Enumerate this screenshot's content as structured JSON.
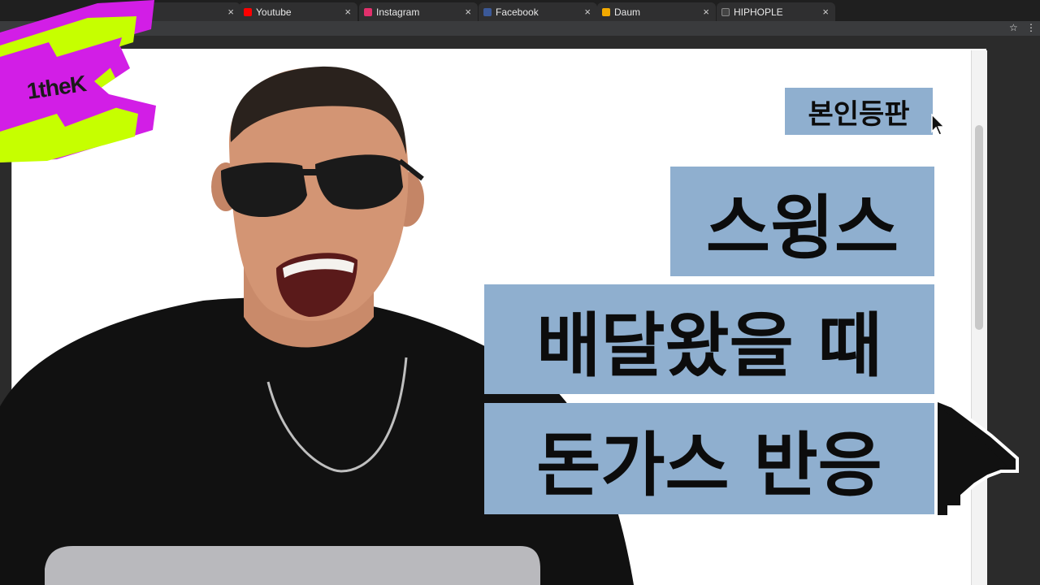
{
  "browser": {
    "tabs": [
      {
        "label": "Youtube",
        "favicon": "youtube-icon",
        "color": "#ff0000"
      },
      {
        "label": "Instagram",
        "favicon": "instagram-icon",
        "color": "#e1306c"
      },
      {
        "label": "Facebook",
        "favicon": "facebook-icon",
        "color": "#3b5998"
      },
      {
        "label": "Daum",
        "favicon": "daum-icon",
        "color": "#f2a900"
      },
      {
        "label": "HIPHOPLE",
        "favicon": "hiphople-icon",
        "color": "#444444"
      }
    ],
    "close_glyph": "×"
  },
  "logo": {
    "text": "1theK",
    "bg_color": "#c6ff00",
    "shadow_color": "#d21ee6"
  },
  "title": {
    "tag": "본인등판",
    "line1": "스윙스",
    "line2": "배달왔을 때",
    "line3": "돈가스 반응"
  },
  "colors": {
    "tag_bg": "#8fafcf",
    "page_bg": "#ffffff"
  }
}
